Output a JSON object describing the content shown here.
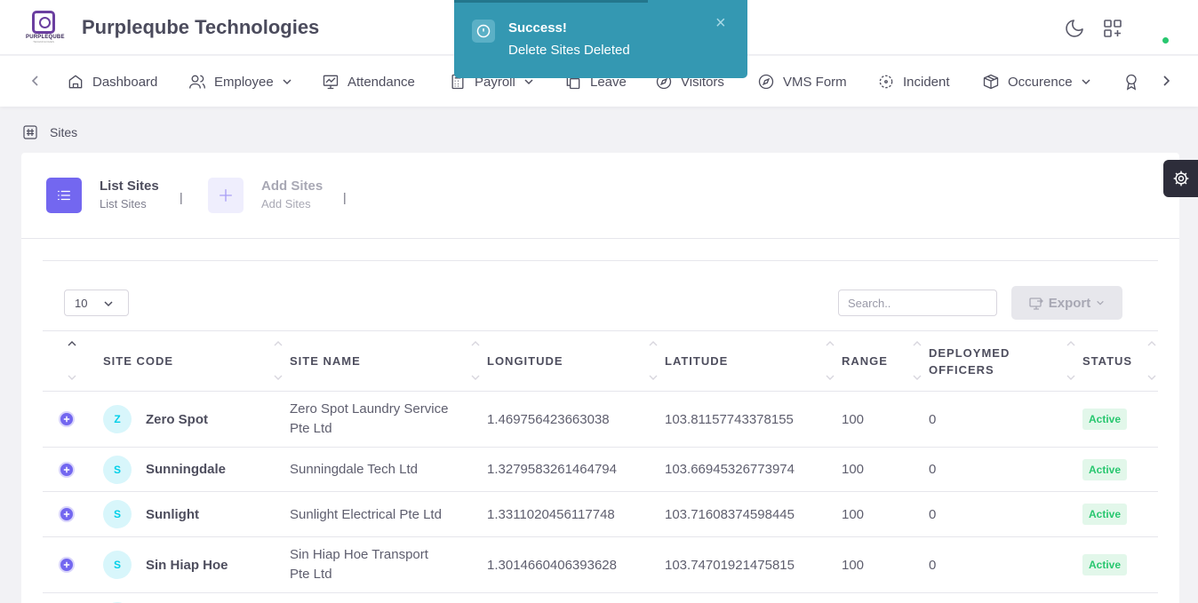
{
  "header": {
    "logo_text": "PURPLEQUBE",
    "logo_sub": "TECHNOLOGIES",
    "company": "Purpleqube Technologies"
  },
  "nav": {
    "items": [
      {
        "label": "Dashboard",
        "icon": "home-icon"
      },
      {
        "label": "Employee",
        "icon": "users-icon",
        "has_dropdown": true
      },
      {
        "label": "Attendance",
        "icon": "monitor-icon"
      },
      {
        "label": "Payroll",
        "icon": "calculator-icon",
        "has_dropdown": true
      },
      {
        "label": "Leave",
        "icon": "copy-icon"
      },
      {
        "label": "Visitors",
        "icon": "compass-icon"
      },
      {
        "label": "VMS Form",
        "icon": "compass-icon"
      },
      {
        "label": "Incident",
        "icon": "crosshair-icon"
      },
      {
        "label": "Occurence",
        "icon": "package-icon",
        "has_dropdown": true
      }
    ]
  },
  "breadcrumb": {
    "label": "Sites"
  },
  "tabs": [
    {
      "title": "List Sites",
      "subtitle": "List Sites",
      "active": true
    },
    {
      "title": "Add Sites",
      "subtitle": "Add Sites",
      "active": false
    }
  ],
  "controls": {
    "page_length": "10",
    "search_placeholder": "Search..",
    "export_label": "Export"
  },
  "table": {
    "columns": [
      "SITE CODE",
      "SITE NAME",
      "LONGITUDE",
      "LATITUDE",
      "RANGE",
      "DEPLOYMED OFFICERS",
      "STATUS"
    ],
    "rows": [
      {
        "initial": "Z",
        "code": "Zero Spot",
        "name": "Zero Spot Laundry Service Pte Ltd",
        "longitude": "1.469756423663038",
        "latitude": "103.81157743378155",
        "range": "100",
        "officers": "0",
        "status": "Active"
      },
      {
        "initial": "S",
        "code": "Sunningdale",
        "name": "Sunningdale Tech Ltd",
        "longitude": "1.3279583261464794",
        "latitude": "103.66945326773974",
        "range": "100",
        "officers": "0",
        "status": "Active"
      },
      {
        "initial": "S",
        "code": "Sunlight",
        "name": "Sunlight Electrical Pte Ltd",
        "longitude": "1.3311020456117748",
        "latitude": "103.71608374598445",
        "range": "100",
        "officers": "0",
        "status": "Active"
      },
      {
        "initial": "S",
        "code": "Sin Hiap Hoe",
        "name": "Sin Hiap Hoe Transport Pte Ltd",
        "longitude": "1.3014660406393628",
        "latitude": "103.74701921475815",
        "range": "100",
        "officers": "0",
        "status": "Active"
      }
    ]
  },
  "toast": {
    "title": "Success!",
    "message": "Delete Sites Deleted",
    "progress": 0.66
  },
  "colors": {
    "accent": "#7367f0",
    "toast_bg": "#3498b2",
    "status_active": "#28c76f",
    "avatar_text": "#00cfe8"
  }
}
